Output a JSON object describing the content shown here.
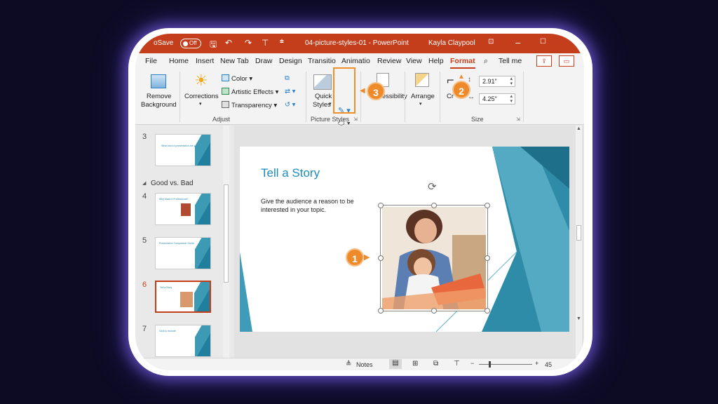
{
  "titlebar": {
    "autosave": "oSave",
    "toggle_state": "Off",
    "doc_title": "04-picture-styles-01 - PowerPoint",
    "user": "Kayla Claypool",
    "icons": [
      "save-icon",
      "undo-icon",
      "redo-icon",
      "present-icon",
      "customize-icon",
      "ribbon-display-icon",
      "maximize-icon"
    ]
  },
  "tabs": [
    "File",
    "Home",
    "Insert",
    "New Tab",
    "Draw",
    "Design",
    "Transitio",
    "Animatio",
    "Review",
    "View",
    "Help",
    "Format"
  ],
  "tell_me": "Tell me",
  "ribbon": {
    "remove_background": [
      "Remove",
      "Background"
    ],
    "corrections": "Corrections",
    "color": "Color",
    "artistic_effects": "Artistic Effects",
    "transparency": "Transparency",
    "adjust_label": "Adjust",
    "quick_styles": [
      "Quick",
      "Styles"
    ],
    "picture_styles_label": "Picture Styles",
    "accessibility": "Accessibility",
    "arrange": "Arrange",
    "crop": "Cr",
    "height": "2.91\"",
    "width": "4.25\"",
    "size_label": "Size"
  },
  "callouts": [
    "1",
    "2",
    "3"
  ],
  "thumbnails": {
    "section_label": "Good vs. Bad",
    "items": [
      {
        "num": "3",
        "title": "What kind of presentation are you giving?"
      },
      {
        "num": "4",
        "title": "Why Make it Professional?"
      },
      {
        "num": "5",
        "title": "Presentation Comparison Guide"
      },
      {
        "num": "6",
        "title": "Tell a Story"
      },
      {
        "num": "7",
        "title": "Click to Include"
      }
    ]
  },
  "slide": {
    "title": "Tell a Story",
    "body": "Give the audience a reason to be interested in your topic."
  },
  "statusbar": {
    "notes": "Notes",
    "zoom": "45"
  },
  "colors": {
    "accent": "#c43e1c",
    "callout": "#ef8a2a",
    "slide_title": "#1e8bbf"
  }
}
